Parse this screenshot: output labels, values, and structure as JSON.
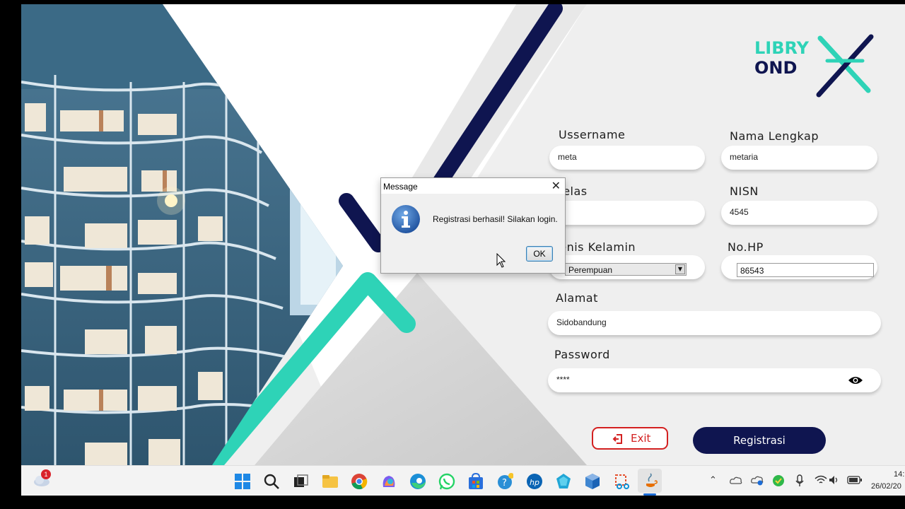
{
  "brand": {
    "line1": "LIBRY",
    "line2": "OND"
  },
  "form": {
    "username": {
      "label": "Ussername",
      "value": "meta"
    },
    "nama_lengkap": {
      "label": "Nama Lengkap",
      "value": "metaria"
    },
    "kelas": {
      "label": "Kelas",
      "value": ""
    },
    "nisn": {
      "label": "NISN",
      "value": "4545"
    },
    "jenis_kelamin": {
      "label": "Jenis Kelamin",
      "selected": "Perempuan"
    },
    "no_hp": {
      "label": "No.HP",
      "value": "86543"
    },
    "alamat": {
      "label": "Alamat",
      "value": "Sidobandung"
    },
    "password": {
      "label": "Password",
      "value": "****"
    }
  },
  "buttons": {
    "exit": "Exit",
    "registrasi": "Registrasi"
  },
  "dialog": {
    "title": "Message",
    "message": "Registrasi berhasil! Silakan login.",
    "ok": "OK"
  },
  "taskbar": {
    "weather_badge": "1",
    "icons": [
      "start-icon",
      "search-icon",
      "task-view-icon",
      "file-explorer-icon",
      "chrome-icon",
      "copilot-icon",
      "edge-icon",
      "whatsapp-icon",
      "store-icon",
      "python-icon",
      "hp-icon",
      "app-icon",
      "virtualbox-icon",
      "snipping-tool-icon",
      "java-icon"
    ],
    "clock_time": "14:",
    "clock_date": "26/02/20"
  },
  "colors": {
    "navy": "#0f1550",
    "teal": "#2ed3b7",
    "exit_red": "#d32020"
  }
}
